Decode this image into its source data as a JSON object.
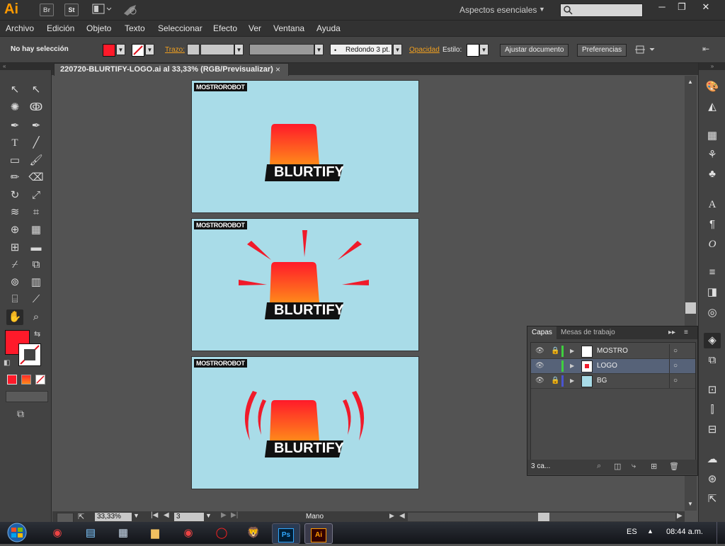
{
  "app": {
    "logo": "Ai",
    "bridge_btn": "Br",
    "stock_btn": "St",
    "workspace": "Aspectos esenciales",
    "window_buttons": [
      "─",
      "❐",
      "✕"
    ]
  },
  "menu": [
    "Archivo",
    "Edición",
    "Objeto",
    "Texto",
    "Seleccionar",
    "Efecto",
    "Ver",
    "Ventana",
    "Ayuda"
  ],
  "control": {
    "selection": "No hay selección",
    "fill_color": "#ff1a2a",
    "stroke_label": "Trazo:",
    "brush": "Redondo 3 pt.",
    "opacity_label": "Opacidad",
    "style_label": "Estilo:",
    "fit_doc": "Ajustar documento",
    "prefs": "Preferencias"
  },
  "document": {
    "tab_title": "220720-BLURTIFY-LOGO.ai al 33,33% (RGB/Previsualizar)",
    "close": "×"
  },
  "artboards": [
    {
      "brand": "MOSTROROBOT",
      "wordmark": "BLURTIFY",
      "variant": "plain"
    },
    {
      "brand": "MOSTROROBOT",
      "wordmark": "BLURTIFY",
      "variant": "rays"
    },
    {
      "brand": "MOSTROROBOT",
      "wordmark": "BLURTIFY",
      "variant": "waves"
    }
  ],
  "layers_panel": {
    "tabs": [
      "Capas",
      "Mesas de trabajo"
    ],
    "layers": [
      {
        "name": "MOSTRO",
        "color": "#3fcf3f",
        "locked": true
      },
      {
        "name": "LOGO",
        "color": "#3fcf3f",
        "locked": false,
        "selected": true
      },
      {
        "name": "BG",
        "color": "#4a54d0",
        "locked": true
      }
    ],
    "count_label": "3 ca..."
  },
  "status": {
    "zoom": "33,33%",
    "artboard_num": "3",
    "tool": "Mano"
  },
  "taskbar": {
    "lang": "ES",
    "time": "08:44 a.m.",
    "apps": [
      "chrome-icon",
      "notes-icon",
      "calculator-icon",
      "folder-icon",
      "chrome-icon",
      "opera-icon",
      "brave-icon",
      "photoshop-icon",
      "illustrator-icon"
    ],
    "ps_label": "Ps",
    "ai_label": "Ai"
  },
  "colors": {
    "accent_orange": "#ff9a00",
    "artboard_bg": "#a9dce8",
    "siren_top": "#ff1a2a",
    "siren_bottom": "#ff8a1a"
  }
}
